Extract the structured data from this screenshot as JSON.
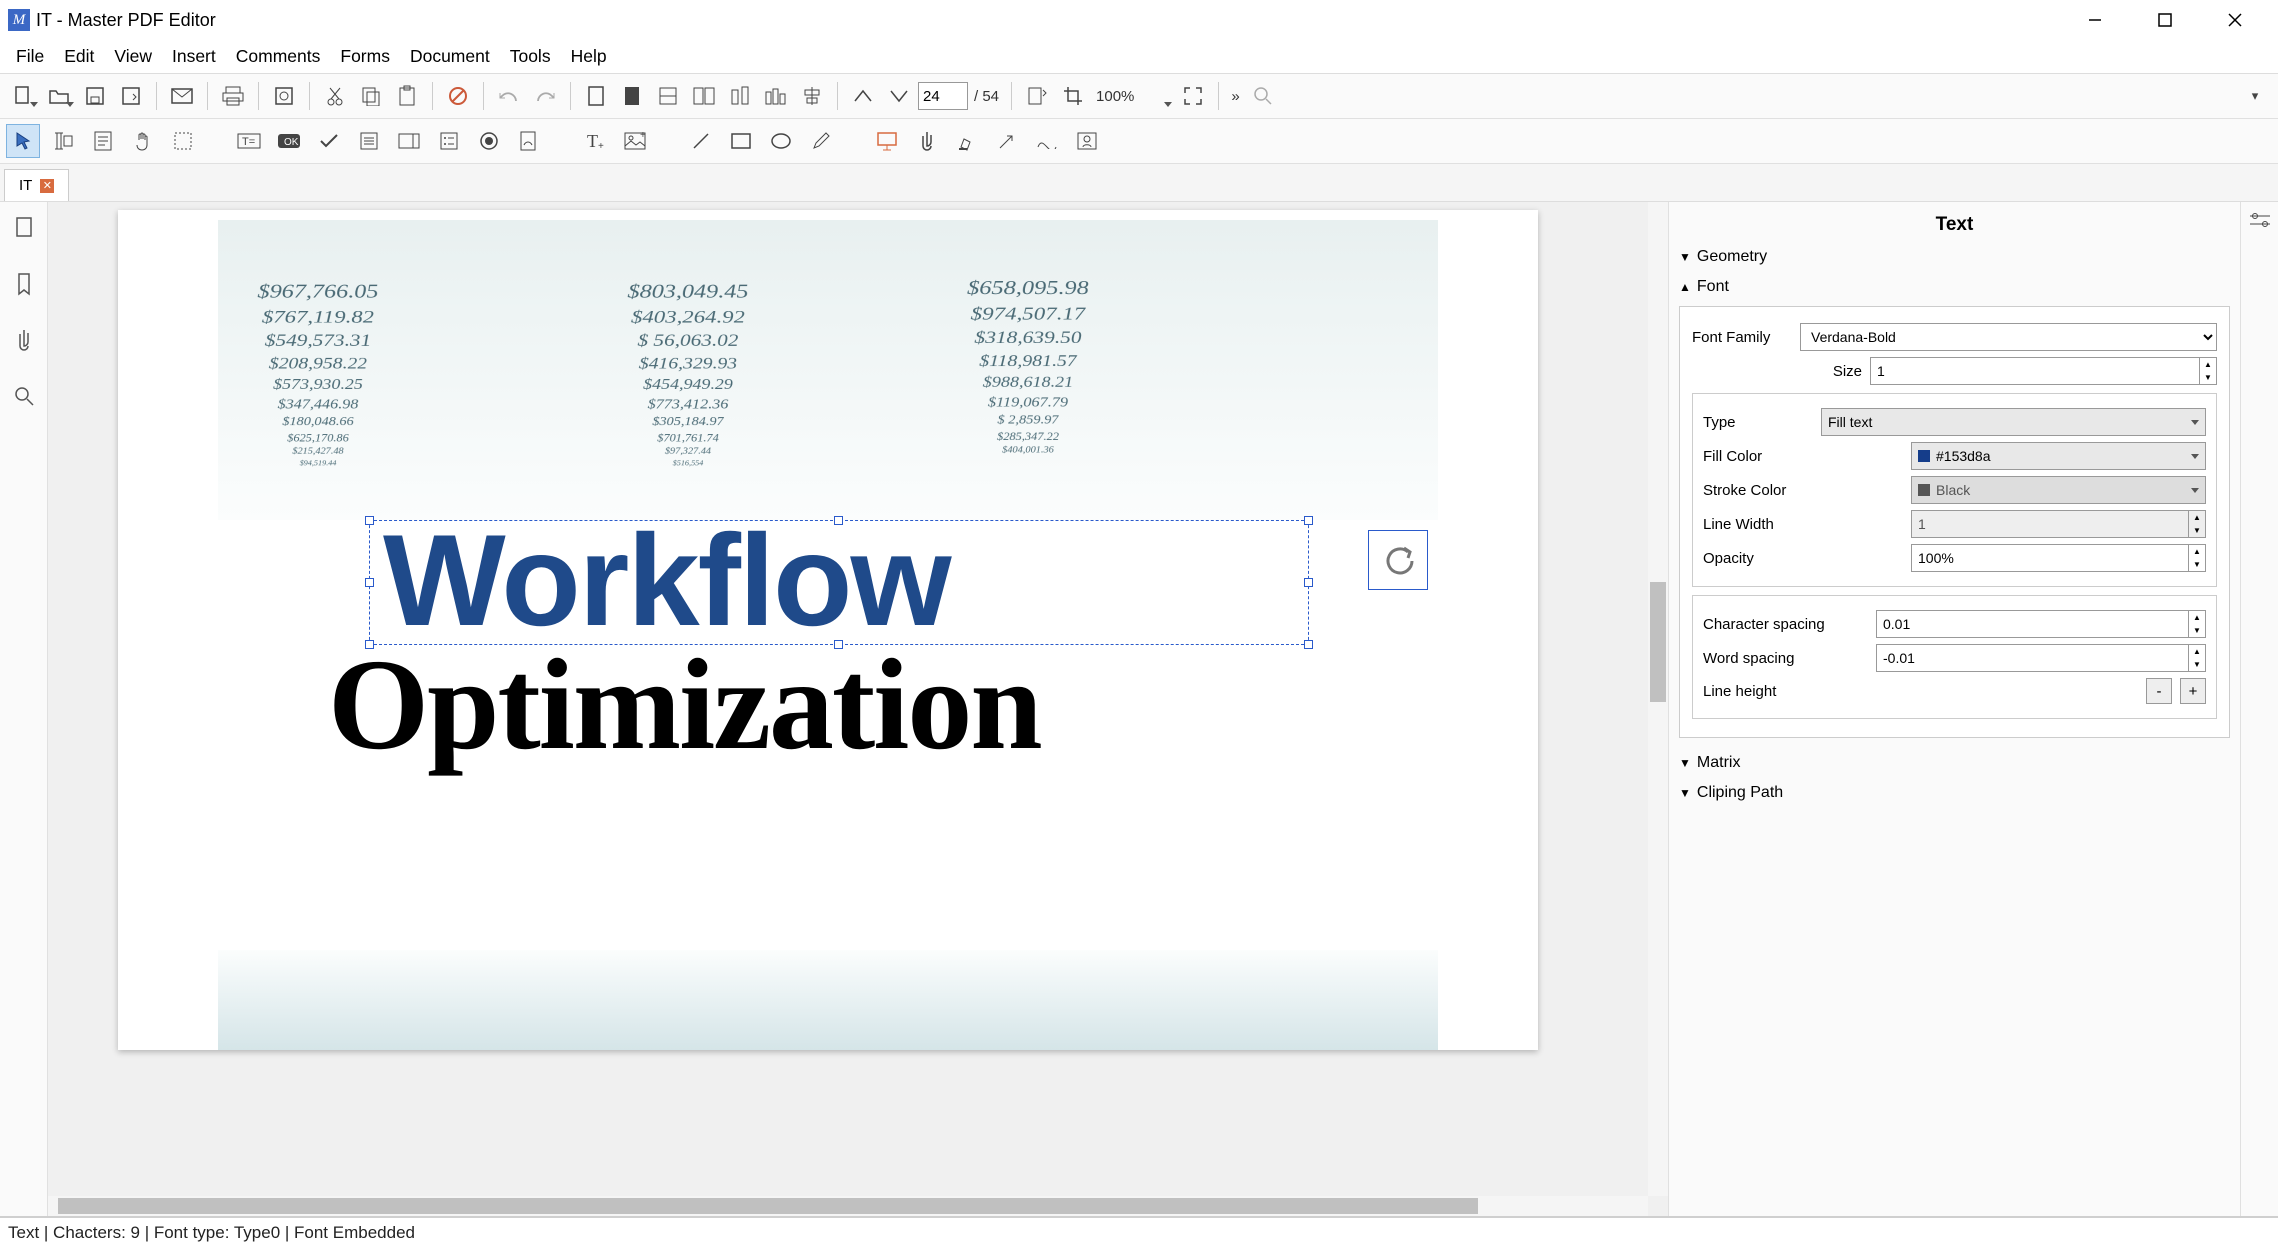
{
  "title": "IT - Master PDF Editor",
  "menu": [
    "File",
    "Edit",
    "View",
    "Insert",
    "Comments",
    "Forms",
    "Document",
    "Tools",
    "Help"
  ],
  "tab": {
    "label": "IT"
  },
  "toolbar": {
    "page_input": "24",
    "page_total": "/ 54",
    "zoom": "100%"
  },
  "document": {
    "word1": "Workflow",
    "word2": "Optimization",
    "numbers": {
      "col1": [
        "$967,766.05",
        "$767,119.82",
        "$549,573.31",
        "$208,958.22",
        "$573,930.25",
        "$347,446.98",
        "$180,048.66",
        "$625,170.86",
        "$215,427.48",
        "$94,519.44"
      ],
      "col2": [
        "$803,049.45",
        "$403,264.92",
        "$  56,063.02",
        "$416,329.93",
        "$454,949.29",
        "$773,412.36",
        "$305,184.97",
        "$701,761.74",
        "$97,327.44",
        "$516,554"
      ],
      "col3": [
        "$658,095.98",
        "$974,507.17",
        "$318,639.50",
        "$118,981.57",
        "$988,618.21",
        "$119,067.79",
        "$  2,859.97",
        "$285,347.22",
        "$404,001.36"
      ]
    }
  },
  "props": {
    "title": "Text",
    "sections": {
      "geometry": "Geometry",
      "font": "Font",
      "matrix": "Matrix",
      "clip": "Cliping Path"
    },
    "font": {
      "family_label": "Font Family",
      "family_value": "Verdana-Bold",
      "size_label": "Size",
      "size_value": "1",
      "type_label": "Type",
      "type_value": "Fill text",
      "fill_label": "Fill Color",
      "fill_value": "#153d8a",
      "fill_swatch": "#153d8a",
      "stroke_label": "Stroke Color",
      "stroke_value": "Black",
      "stroke_swatch": "#555555",
      "lw_label": "Line Width",
      "lw_value": "1",
      "opacity_label": "Opacity",
      "opacity_value": "100%",
      "cs_label": "Character spacing",
      "cs_value": "0.01",
      "ws_label": "Word spacing",
      "ws_value": "-0.01",
      "lh_label": "Line height",
      "lh_minus": "-",
      "lh_plus": "+"
    }
  },
  "statusbar": "Text | Chacters: 9 | Font type: Type0 | Font Embedded"
}
